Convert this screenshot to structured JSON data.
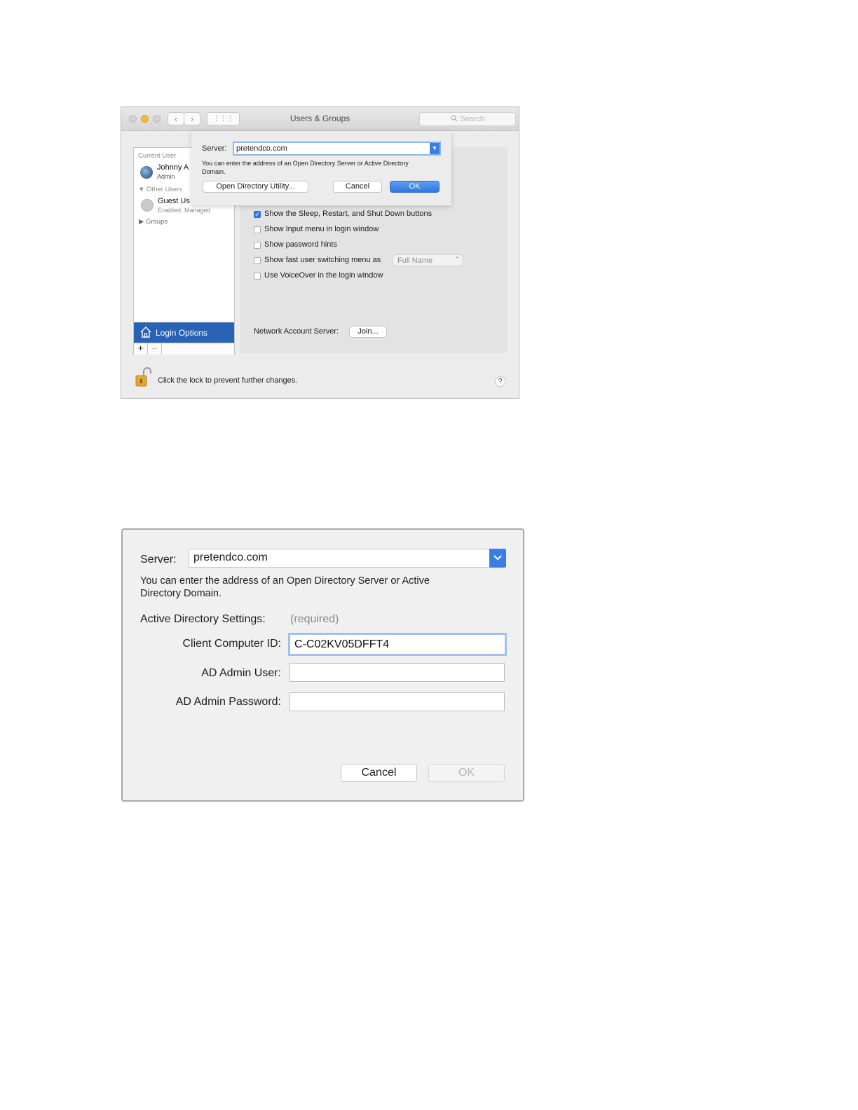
{
  "window1": {
    "title": "Users & Groups",
    "search_placeholder": "Search",
    "nav_back": "‹",
    "nav_forward": "›",
    "grid": "⋮⋮⋮",
    "sidebar": {
      "current_user_heading": "Current User",
      "current_user_name": "Johnny A",
      "current_user_role": "Admin",
      "other_users_heading": "Other Users",
      "guest_name": "Guest Us",
      "guest_status": "Enabled, Managed",
      "groups_label": "Groups",
      "login_options_label": "Login Options",
      "add_label": "+",
      "remove_label": "–"
    },
    "options": [
      {
        "label": "Show the Sleep, Restart, and Shut Down buttons",
        "checked": true
      },
      {
        "label": "Show Input menu in login window",
        "checked": false
      },
      {
        "label": "Show password hints",
        "checked": false
      },
      {
        "label": "Show fast user switching menu as",
        "checked": false
      },
      {
        "label": "Use VoiceOver in the login window",
        "checked": false
      }
    ],
    "fast_switch_value": "Full Name",
    "network_account_label": "Network Account Server:",
    "join_button": "Join...",
    "lock_text": "Click the lock to prevent further changes.",
    "help_label": "?",
    "sheet": {
      "server_label": "Server:",
      "server_value": "pretendco.com",
      "hint": "You can enter the address of an Open Directory Server or Active Directory Domain.",
      "open_directory_button": "Open Directory Utility...",
      "cancel_button": "Cancel",
      "ok_button": "OK"
    }
  },
  "window2": {
    "server_label": "Server:",
    "server_value": "pretendco.com",
    "hint_line1": "You can enter the address of an Open Directory Server or Active",
    "hint_line2": "Directory Domain.",
    "ad_settings_label": "Active Directory Settings:",
    "ad_required": "(required)",
    "client_id_label": "Client Computer ID:",
    "client_id_value": "C-C02KV05DFFT4",
    "admin_user_label": "AD Admin User:",
    "admin_user_value": "",
    "admin_password_label": "AD Admin Password:",
    "admin_password_value": "",
    "cancel_button": "Cancel",
    "ok_button": "OK"
  }
}
